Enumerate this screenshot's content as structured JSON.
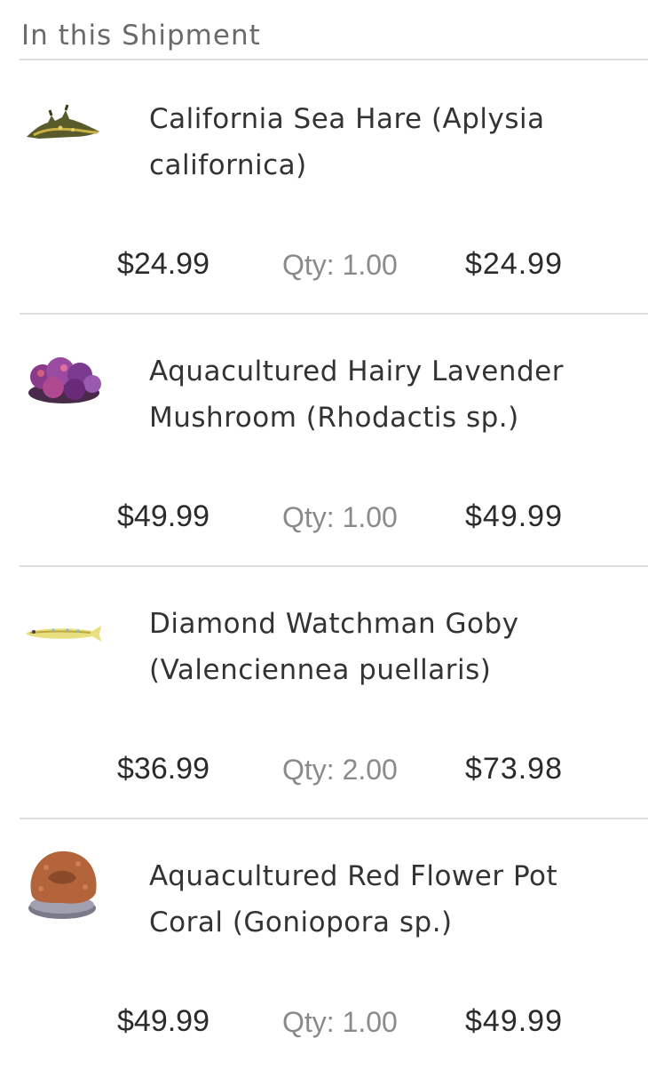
{
  "section": {
    "title": "In this Shipment"
  },
  "items": [
    {
      "name_line1": "California Sea Hare (Aplysia",
      "name_line2": "californica)",
      "unit_price": "$24.99",
      "qty": "Qty: 1.00",
      "total": "$24.99",
      "image_icon": "sea-hare-thumbnail"
    },
    {
      "name_line1": "Aquacultured Hairy Lavender",
      "name_line2": "Mushroom (Rhodactis sp.)",
      "unit_price": "$49.99",
      "qty": "Qty: 1.00",
      "total": "$49.99",
      "image_icon": "lavender-mushroom-coral-thumbnail"
    },
    {
      "name_line1": "Diamond Watchman Goby",
      "name_line2": "(Valenciennea puellaris)",
      "unit_price": "$36.99",
      "qty": "Qty: 2.00",
      "total": "$73.98",
      "image_icon": "goby-fish-thumbnail"
    },
    {
      "name_line1": "Aquacultured Red Flower Pot",
      "name_line2": "Coral (Goniopora sp.)",
      "unit_price": "$49.99",
      "qty": "Qty: 1.00",
      "total": "$49.99",
      "image_icon": "flower-pot-coral-thumbnail"
    }
  ],
  "colors": {
    "divider": "#dcdcdc",
    "text_primary": "#2b2b2b",
    "text_muted": "#8a8a8a",
    "header_text": "#6a6a6a"
  }
}
